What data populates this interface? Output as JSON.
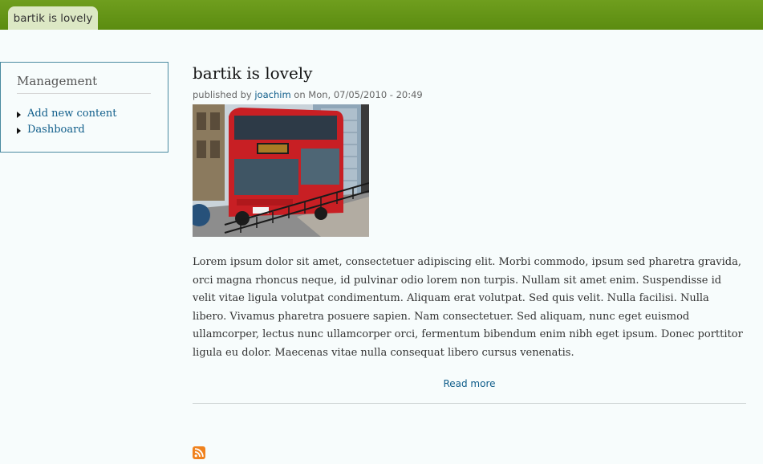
{
  "header": {
    "tab_label": "bartik is lovely"
  },
  "sidebar": {
    "title": "Management",
    "items": [
      {
        "label": "Add new content"
      },
      {
        "label": "Dashboard"
      }
    ]
  },
  "article": {
    "title": "bartik is lovely",
    "meta_prefix": "published by ",
    "author": "joachim",
    "meta_suffix": " on Mon, 07/05/2010 - 20:49",
    "body": "Lorem ipsum dolor sit amet, consectetuer adipiscing elit. Morbi commodo, ipsum sed pharetra gravida, orci magna rhoncus neque, id pulvinar odio lorem non turpis. Nullam sit amet enim. Suspendisse id velit vitae ligula volutpat condimentum. Aliquam erat volutpat. Sed quis velit. Nulla facilisi. Nulla libero. Vivamus pharetra posuere sapien. Nam consectetuer. Sed aliquam, nunc eget euismod ullamcorper, lectus nunc ullamcorper orci, fermentum bibendum enim nibh eget ipsum. Donec porttitor ligula eu dolor. Maecenas vitae nulla consequat libero cursus venenatis.",
    "read_more": "Read more",
    "image_icon": "red-double-decker-bus-photo"
  },
  "footer": {
    "feed_icon": "rss-icon"
  },
  "colors": {
    "header_green": "#5b8c10",
    "tab_bg": "#dce8c4",
    "link": "#0f5d8a",
    "page_bg": "#f7fcfc",
    "sidebar_border": "#4a8aa0",
    "rss_orange": "#f0821e"
  }
}
